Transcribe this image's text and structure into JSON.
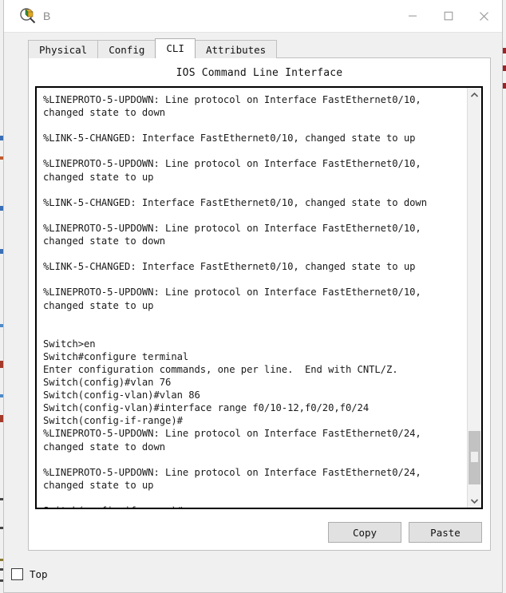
{
  "window": {
    "title": "B",
    "icon": "inspect-magnifier-icon",
    "controls": {
      "minimize": "—",
      "maximize": "□",
      "close": "✕"
    }
  },
  "tabs": [
    {
      "label": "Physical",
      "active": false
    },
    {
      "label": "Config",
      "active": false
    },
    {
      "label": "CLI",
      "active": true
    },
    {
      "label": "Attributes",
      "active": false
    }
  ],
  "panel": {
    "title": "IOS Command Line Interface"
  },
  "terminal": {
    "text": "%LINEPROTO-5-UPDOWN: Line protocol on Interface FastEthernet0/10,\nchanged state to down\n\n%LINK-5-CHANGED: Interface FastEthernet0/10, changed state to up\n\n%LINEPROTO-5-UPDOWN: Line protocol on Interface FastEthernet0/10,\nchanged state to up\n\n%LINK-5-CHANGED: Interface FastEthernet0/10, changed state to down\n\n%LINEPROTO-5-UPDOWN: Line protocol on Interface FastEthernet0/10,\nchanged state to down\n\n%LINK-5-CHANGED: Interface FastEthernet0/10, changed state to up\n\n%LINEPROTO-5-UPDOWN: Line protocol on Interface FastEthernet0/10,\nchanged state to up\n\n\nSwitch>en\nSwitch#configure terminal\nEnter configuration commands, one per line.  End with CNTL/Z.\nSwitch(config)#vlan 76\nSwitch(config-vlan)#vlan 86\nSwitch(config-vlan)#interface range f0/10-12,f0/20,f0/24\nSwitch(config-if-range)#\n%LINEPROTO-5-UPDOWN: Line protocol on Interface FastEthernet0/24,\nchanged state to down\n\n%LINEPROTO-5-UPDOWN: Line protocol on Interface FastEthernet0/24,\nchanged state to up\n\nSwitch(config-if-range)#",
    "scrollbar": {
      "up_arrow": "▲",
      "down_arrow": "▼"
    }
  },
  "actions": {
    "copy_label": "Copy",
    "paste_label": "Paste"
  },
  "footer": {
    "top_label": "Top",
    "top_checked": false
  },
  "colors": {
    "titlebar_bg": "#ffffff",
    "window_bg": "#f0f0f0",
    "panel_bg": "#ffffff",
    "terminal_border": "#000000",
    "button_bg": "#e1e1e1",
    "text": "#1a1a1a"
  }
}
